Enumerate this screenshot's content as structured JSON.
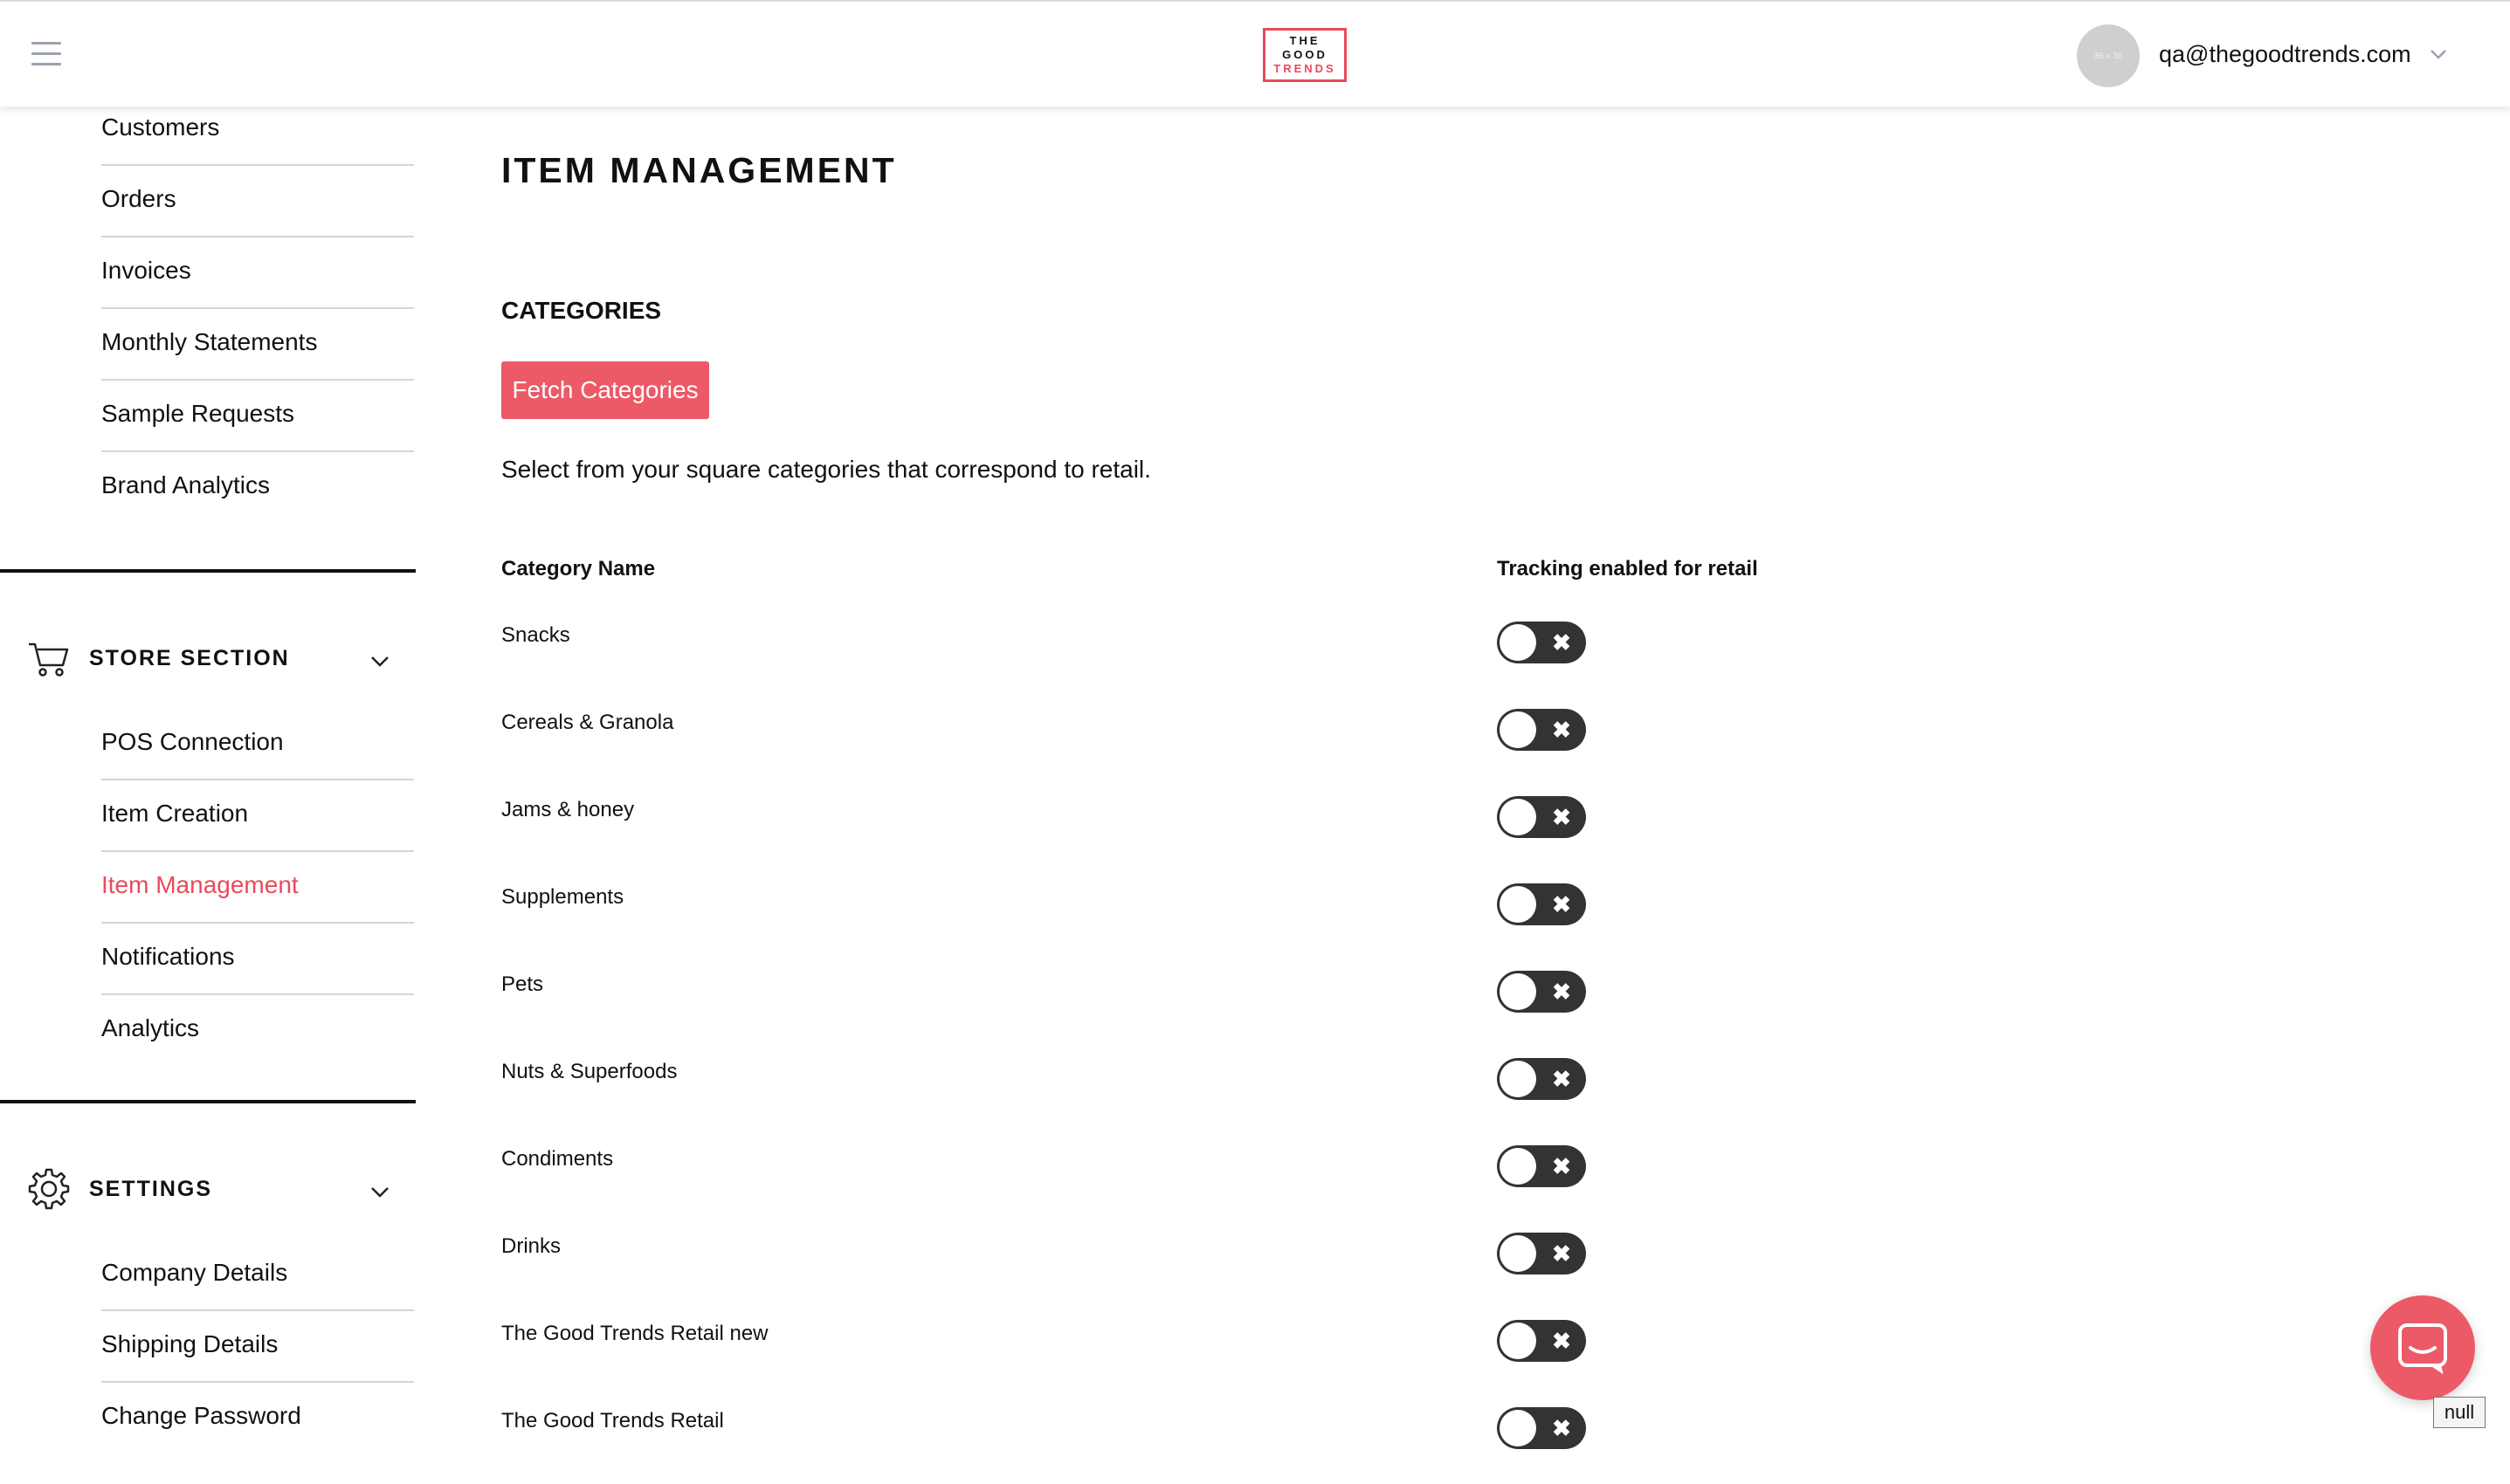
{
  "header": {
    "logo_line1": "THE",
    "logo_line2": "GOOD",
    "logo_line3": "TRENDS",
    "avatar_text": "36 x 36",
    "user_email": "qa@thegoodtrends.com"
  },
  "sidebar": {
    "account_items": [
      {
        "label": "Customers"
      },
      {
        "label": "Orders"
      },
      {
        "label": "Invoices"
      },
      {
        "label": "Monthly Statements"
      },
      {
        "label": "Sample Requests"
      },
      {
        "label": "Brand Analytics"
      }
    ],
    "store_section": {
      "title": "STORE SECTION",
      "icon": "cart-icon",
      "items": [
        {
          "label": "POS Connection"
        },
        {
          "label": "Item Creation"
        },
        {
          "label": "Item Management",
          "active": true
        },
        {
          "label": "Notifications"
        },
        {
          "label": "Analytics"
        }
      ]
    },
    "settings_section": {
      "title": "SETTINGS",
      "icon": "gear-icon",
      "items": [
        {
          "label": "Company Details"
        },
        {
          "label": "Shipping Details"
        },
        {
          "label": "Change Password"
        }
      ]
    }
  },
  "main": {
    "page_title": "ITEM MANAGEMENT",
    "categories_title": "CATEGORIES",
    "fetch_button_label": "Fetch Categories",
    "helper_text": "Select from your square categories that correspond to retail.",
    "table": {
      "col_name": "Category Name",
      "col_tracking": "Tracking enabled for retail",
      "rows": [
        {
          "name": "Snacks",
          "tracking_enabled": false
        },
        {
          "name": "Cereals & Granola",
          "tracking_enabled": false
        },
        {
          "name": "Jams & honey",
          "tracking_enabled": false
        },
        {
          "name": "Supplements",
          "tracking_enabled": false
        },
        {
          "name": "Pets",
          "tracking_enabled": false
        },
        {
          "name": "Nuts & Superfoods",
          "tracking_enabled": false
        },
        {
          "name": "Condiments",
          "tracking_enabled": false
        },
        {
          "name": "Drinks",
          "tracking_enabled": false
        },
        {
          "name": "The Good Trends Retail new",
          "tracking_enabled": false
        },
        {
          "name": "The Good Trends Retail",
          "tracking_enabled": false
        }
      ]
    }
  },
  "colors": {
    "accent": "#e94b5a",
    "button": "#ec5a67",
    "toggle_off": "#333333"
  },
  "chat": {
    "icon": "chat-icon",
    "null_label": "null"
  }
}
